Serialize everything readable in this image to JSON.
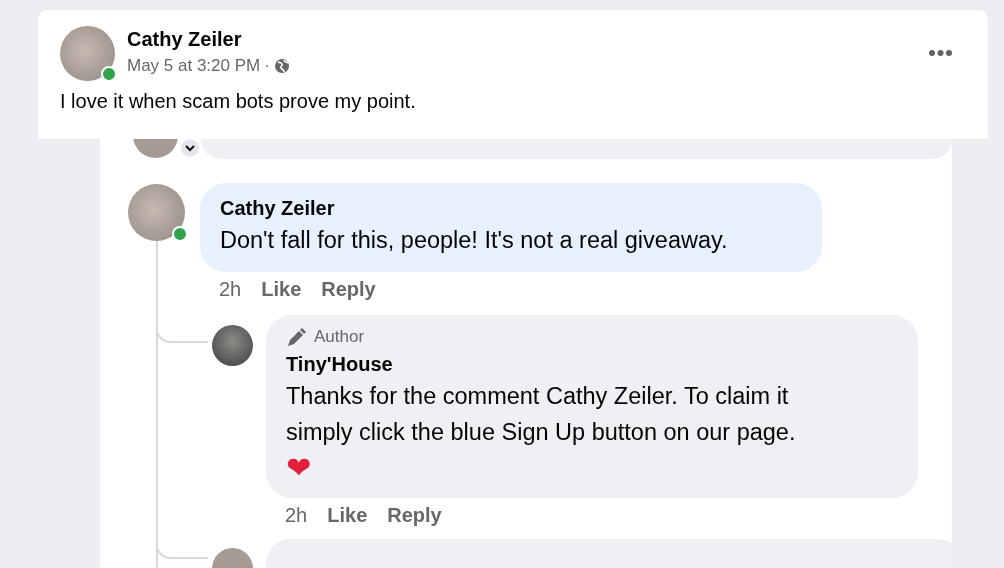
{
  "post": {
    "author": "Cathy Zeiler",
    "online": true,
    "time": "May 5 at 3:20 PM",
    "separator": "·",
    "text": "I love it when scam bots prove my point."
  },
  "comments": [
    {
      "author": "Cathy Zeiler",
      "online": true,
      "color": "#e7f1fd",
      "text": "Don't fall for this, people! It's not a real giveaway.",
      "time": "2h",
      "actions": [
        "Like",
        "Reply"
      ],
      "replies": [
        {
          "badge": "Author",
          "author": "Tiny'House",
          "online": false,
          "color": "#eff0f3",
          "text": "Thanks for the comment Cathy Zeiler. To claim it simply click the blue Sign Up button on our page.",
          "reaction": "❤",
          "time": "2h",
          "actions": [
            "Like",
            "Reply"
          ]
        }
      ]
    }
  ]
}
